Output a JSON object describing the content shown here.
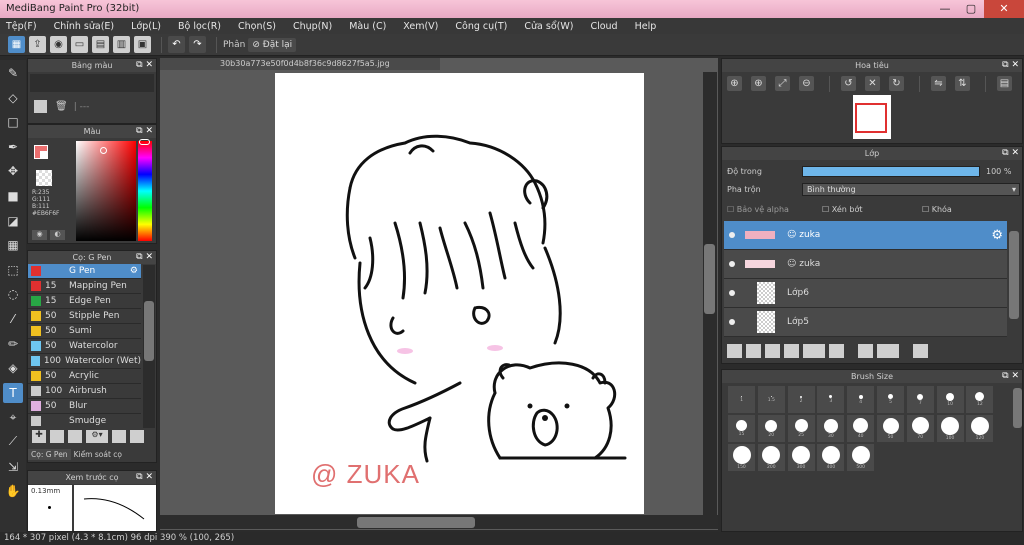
{
  "window": {
    "title": "MediBang Paint Pro (32bit)",
    "min": "—",
    "max": "▢",
    "close": "✕"
  },
  "menu": [
    "Tệp(F)",
    "Chỉnh sửa(E)",
    "Lớp(L)",
    "Bộ lọc(R)",
    "Chọn(S)",
    "Chụp(N)",
    "Màu (C)",
    "Xem(V)",
    "Công cụ(T)",
    "Cửa sổ(W)",
    "Cloud",
    "Help"
  ],
  "toolbar": {
    "snap_label": "Phân",
    "snap_value": "Đặt lại"
  },
  "document": {
    "tab": "30b30a773e50f0d4b8f36c9d8627f5a5.jpg"
  },
  "color_panel": {
    "title": "Bảng màu",
    "picker_title": "Màu",
    "rgb": {
      "r": "R:235",
      "g": "G:111",
      "b": "B:111",
      "hex": "#EB6F6F"
    }
  },
  "brush_panel": {
    "title": "Cọ: G Pen",
    "brushes": [
      {
        "size": "",
        "name": "G Pen",
        "color": "#e03030",
        "selected": true
      },
      {
        "size": "15",
        "name": "Mapping Pen",
        "color": "#e03030",
        "selected": false
      },
      {
        "size": "15",
        "name": "Edge Pen",
        "color": "#28a745",
        "selected": false
      },
      {
        "size": "50",
        "name": "Stipple Pen",
        "color": "#f0c020",
        "selected": false
      },
      {
        "size": "50",
        "name": "Sumi",
        "color": "#f0c020",
        "selected": false
      },
      {
        "size": "50",
        "name": "Watercolor",
        "color": "#6ec6f0",
        "selected": false
      },
      {
        "size": "100",
        "name": "Watercolor (Wet)",
        "color": "#6ec6f0",
        "selected": false
      },
      {
        "size": "50",
        "name": "Acrylic",
        "color": "#f0c020",
        "selected": false
      },
      {
        "size": "100",
        "name": "Airbrush",
        "color": "#cccccc",
        "selected": false
      },
      {
        "size": "50",
        "name": "Blur",
        "color": "#e0b0e0",
        "selected": false
      },
      {
        "size": "",
        "name": "Smudge",
        "color": "#cccccc",
        "selected": false
      }
    ],
    "tabs": [
      "Cọ: G Pen",
      "Kiểm soát cọ"
    ]
  },
  "preview_panel": {
    "title": "Xem trước cọ",
    "size": "0.13mm"
  },
  "navigator": {
    "title": "Hoa tiêu"
  },
  "layer_panel": {
    "title": "Lớp",
    "opacity_label": "Độ trong",
    "opacity_value": "100 %",
    "opacity_level": 1.0,
    "blend_label": "Pha trộn",
    "blend_value": "Bình thường",
    "checkboxes": [
      "Bảo vệ alpha",
      "Xén bớt",
      "Khóa"
    ],
    "layers": [
      {
        "name": "☺ zuka",
        "selected": true
      },
      {
        "name": "☺ zuka",
        "selected": false
      },
      {
        "name": "Lớp6",
        "selected": false
      },
      {
        "name": "Lớp5",
        "selected": false
      }
    ]
  },
  "brush_size_panel": {
    "title": "Brush Size",
    "row1": [
      "1",
      "1.5",
      "2",
      "3",
      "4",
      "5",
      "7",
      "10",
      "12"
    ],
    "row2": [
      "15",
      "20",
      "25",
      "30",
      "40",
      "50",
      "70",
      "100",
      "120"
    ],
    "row3": [
      "150",
      "200",
      "300",
      "400",
      "500"
    ]
  },
  "signature": "@ ZUKA",
  "status": {
    "text": "164 * 307 pixel   (4.3 * 8.1cm)  96 dpi   390 %   (100, 265)"
  },
  "colors": {
    "accent": "#4f8dc9",
    "current_color": "#EB6F6F",
    "titlebar": "#f0bcd2"
  }
}
